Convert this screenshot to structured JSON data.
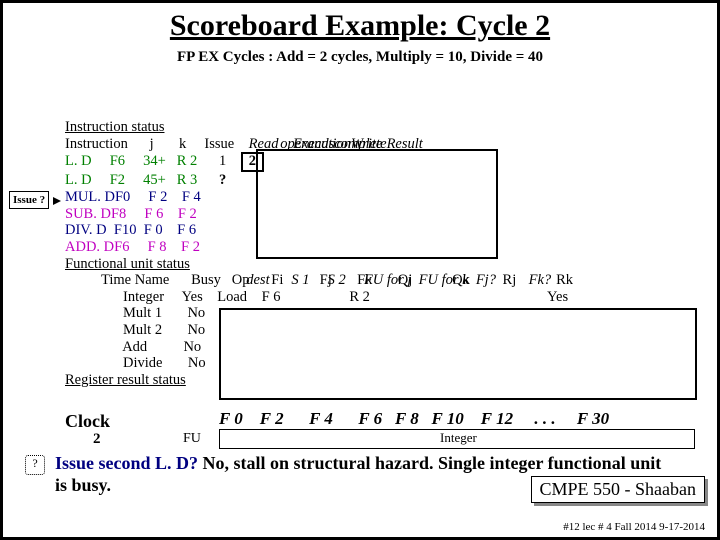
{
  "title": "Scoreboard Example:  Cycle 2",
  "subtitle": "FP EX Cycles :  Add = 2 cycles, Multiply = 10, Divide = 40",
  "issue_q": "Issue ?",
  "inst": {
    "status_hdr": "Instruction status",
    "cols": {
      "instr": "Instruction",
      "j": "j",
      "k": "k",
      "issue": "Issue",
      "read": "Read",
      "exec": "Execution",
      "write": "Write"
    },
    "cols2": {
      "operands": "operands",
      "complete": "complete",
      "result": "Result"
    },
    "rows": [
      {
        "op": "L. D",
        "d": "F6",
        "j": "34+",
        "k": "R 2",
        "issue": "1",
        "read": "2"
      },
      {
        "op": "L. D",
        "d": "F2",
        "j": "45+",
        "k": "R 3",
        "issue": "?"
      },
      {
        "op": "MUL. D",
        "d": "F0",
        "j": "F 2",
        "k": "F 4"
      },
      {
        "op": "SUB. D",
        "d": "F8",
        "j": "F 6",
        "k": "F 2"
      },
      {
        "op": "DIV. D",
        "d": "F10",
        "j": "F 0",
        "k": "F 6"
      },
      {
        "op": "ADD. D",
        "d": "F6",
        "j": "F 8",
        "k": "F 2"
      }
    ]
  },
  "fu": {
    "hdr": "Functional unit status",
    "time": "Time",
    "name": "Name",
    "cols": {
      "busy": "Busy",
      "op": "Op",
      "dest": "dest",
      "fi": "Fi",
      "s1": "S 1",
      "fj": "Fj",
      "s2": "S 2",
      "fk": "Fk",
      "fuj": "FU for j",
      "qj": "Qj",
      "fuk": "FU for k",
      "qk": "Qk",
      "fjq": "Fj?",
      "rj": "Rj",
      "fkq": "Fk?",
      "rk": "Rk"
    },
    "rows": [
      {
        "name": "Integer",
        "busy": "Yes",
        "op": "Load",
        "fi": "F 6",
        "fj": "",
        "fk": "R 2",
        "qj": "",
        "qk": "",
        "rj": "",
        "rk": "Yes"
      },
      {
        "name": "Mult 1",
        "busy": "No"
      },
      {
        "name": "Mult 2",
        "busy": "No"
      },
      {
        "name": "Add",
        "busy": "No"
      },
      {
        "name": "Divide",
        "busy": "No"
      }
    ]
  },
  "regres_hdr": "Register result status",
  "clock_label": "Clock",
  "clock_val": "2",
  "fu_label": "FU",
  "regs": [
    "F 0",
    "F 2",
    "F 4",
    "F 6",
    "F 8",
    "F 10",
    "F 12",
    ". . .",
    "F 30"
  ],
  "reg_fu": "Integer",
  "bottom_q": "?",
  "bottom_text_a": "Issue second L. D?",
  "bottom_text_b": "   No, stall on structural hazard.  Single integer functional unit is busy.",
  "course": "CMPE 550 - Shaaban",
  "footer": "#12  lec # 4 Fall 2014   9-17-2014"
}
